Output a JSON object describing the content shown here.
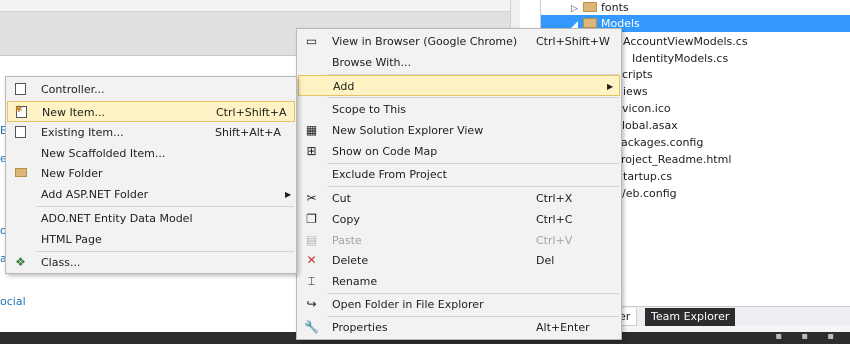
{
  "editor": {
    "edge_chars": [
      "E",
      "e",
      "or",
      "a"
    ],
    "link_text": "ocial"
  },
  "explorer": {
    "tree": [
      {
        "label": "fonts",
        "expanded": false,
        "selected": false
      },
      {
        "label": "Models",
        "expanded": true,
        "selected": true
      },
      {
        "label": "AccountViewModels.cs"
      },
      {
        "label": "IdentityModels.cs"
      },
      {
        "label": "cripts"
      },
      {
        "label": "iews"
      },
      {
        "label": "vicon.ico"
      },
      {
        "label": "lobal.asax"
      },
      {
        "label": "ackages.config"
      },
      {
        "label": "roject_Readme.html"
      },
      {
        "label": "tartup.cs"
      },
      {
        "label": "/eb.config"
      }
    ],
    "tabs": [
      "orer",
      "Team Explorer"
    ]
  },
  "main_menu": {
    "items": [
      {
        "label": "View in Browser (Google Chrome)",
        "shortcut": "Ctrl+Shift+W",
        "icon": "browser-icon"
      },
      {
        "label": "Browse With...",
        "shortcut": ""
      },
      {
        "label": "Add",
        "shortcut": "",
        "submenu": true,
        "highlighted": true
      },
      {
        "label": "Scope to This",
        "shortcut": ""
      },
      {
        "label": "New Solution Explorer View",
        "shortcut": "",
        "icon": "new-view-icon"
      },
      {
        "label": "Show on Code Map",
        "shortcut": "",
        "icon": "code-map-icon"
      },
      {
        "label": "Exclude From Project",
        "shortcut": ""
      },
      {
        "label": "Cut",
        "shortcut": "Ctrl+X",
        "icon": "scissors-icon"
      },
      {
        "label": "Copy",
        "shortcut": "Ctrl+C",
        "icon": "copy-icon"
      },
      {
        "label": "Paste",
        "shortcut": "Ctrl+V",
        "icon": "paste-icon",
        "disabled": true
      },
      {
        "label": "Delete",
        "shortcut": "Del",
        "icon": "delete-icon"
      },
      {
        "label": "Rename",
        "shortcut": "",
        "icon": "rename-icon"
      },
      {
        "label": "Open Folder in File Explorer",
        "shortcut": "",
        "icon": "open-folder-icon"
      },
      {
        "label": "Properties",
        "shortcut": "Alt+Enter",
        "icon": "wrench-icon"
      }
    ]
  },
  "sub_menu": {
    "items": [
      {
        "label": "Controller...",
        "shortcut": "",
        "icon": "controller-icon"
      },
      {
        "label": "New Item...",
        "shortcut": "Ctrl+Shift+A",
        "icon": "new-item-icon",
        "highlighted": true
      },
      {
        "label": "Existing Item...",
        "shortcut": "Shift+Alt+A",
        "icon": "existing-item-icon"
      },
      {
        "label": "New Scaffolded Item...",
        "shortcut": ""
      },
      {
        "label": "New Folder",
        "shortcut": "",
        "icon": "folder-icon"
      },
      {
        "label": "Add ASP.NET Folder",
        "shortcut": "",
        "submenu": true
      },
      {
        "label": "ADO.NET Entity Data Model",
        "shortcut": ""
      },
      {
        "label": "HTML Page",
        "shortcut": ""
      },
      {
        "label": "Class...",
        "shortcut": "",
        "icon": "class-icon"
      }
    ]
  },
  "colors": {
    "highlight_bg": "#fff3c5",
    "highlight_border": "#e5c365",
    "selection_blue": "#3399ff",
    "delete_red": "#d13438"
  }
}
